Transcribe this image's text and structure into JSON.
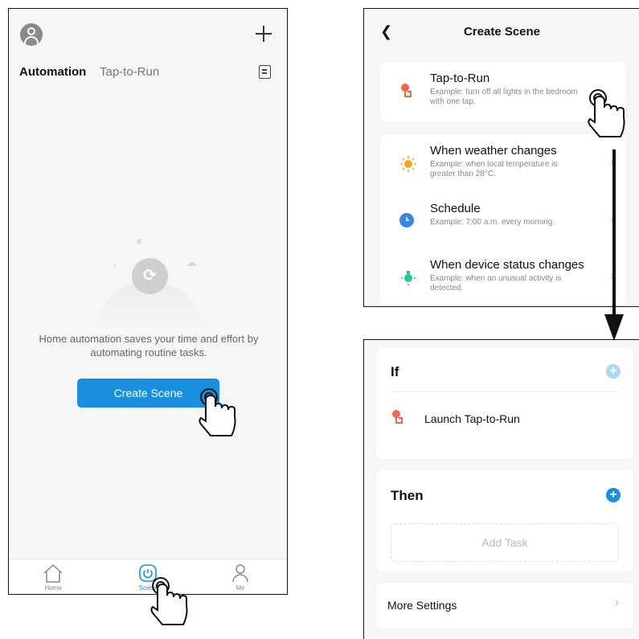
{
  "left_screen": {
    "tabs": [
      "Automation",
      "Tap-to-Run"
    ],
    "empty_message": "Home automation saves your time and effort by automating routine tasks.",
    "create_button": "Create Scene",
    "nav": [
      "Home",
      "Scene",
      "Me"
    ]
  },
  "create_scene": {
    "title": "Create Scene",
    "options": [
      {
        "title": "Tap-to-Run",
        "subtitle": "Example: turn off all lights in the bedroom with one tap.",
        "icon": "hand-tap-icon",
        "color": "#f2664b"
      },
      {
        "title": "When weather changes",
        "subtitle": "Example: when local temperature is greater than 28°C.",
        "icon": "sun-icon",
        "color": "#f7a823"
      },
      {
        "title": "Schedule",
        "subtitle": "Example: 7:00 a.m. every morning.",
        "icon": "clock-icon",
        "color": "#3a86e8"
      },
      {
        "title": "When device status changes",
        "subtitle": "Example: when an unusual activity is detected.",
        "icon": "bulb-icon",
        "color": "#20c997"
      }
    ]
  },
  "scene_editor": {
    "if_title": "If",
    "if_item": "Launch Tap-to-Run",
    "then_title": "Then",
    "add_task": "Add Task",
    "more_settings": "More Settings"
  },
  "colors": {
    "accent": "#1a8fdd",
    "add_if": "#a9d8f6"
  }
}
